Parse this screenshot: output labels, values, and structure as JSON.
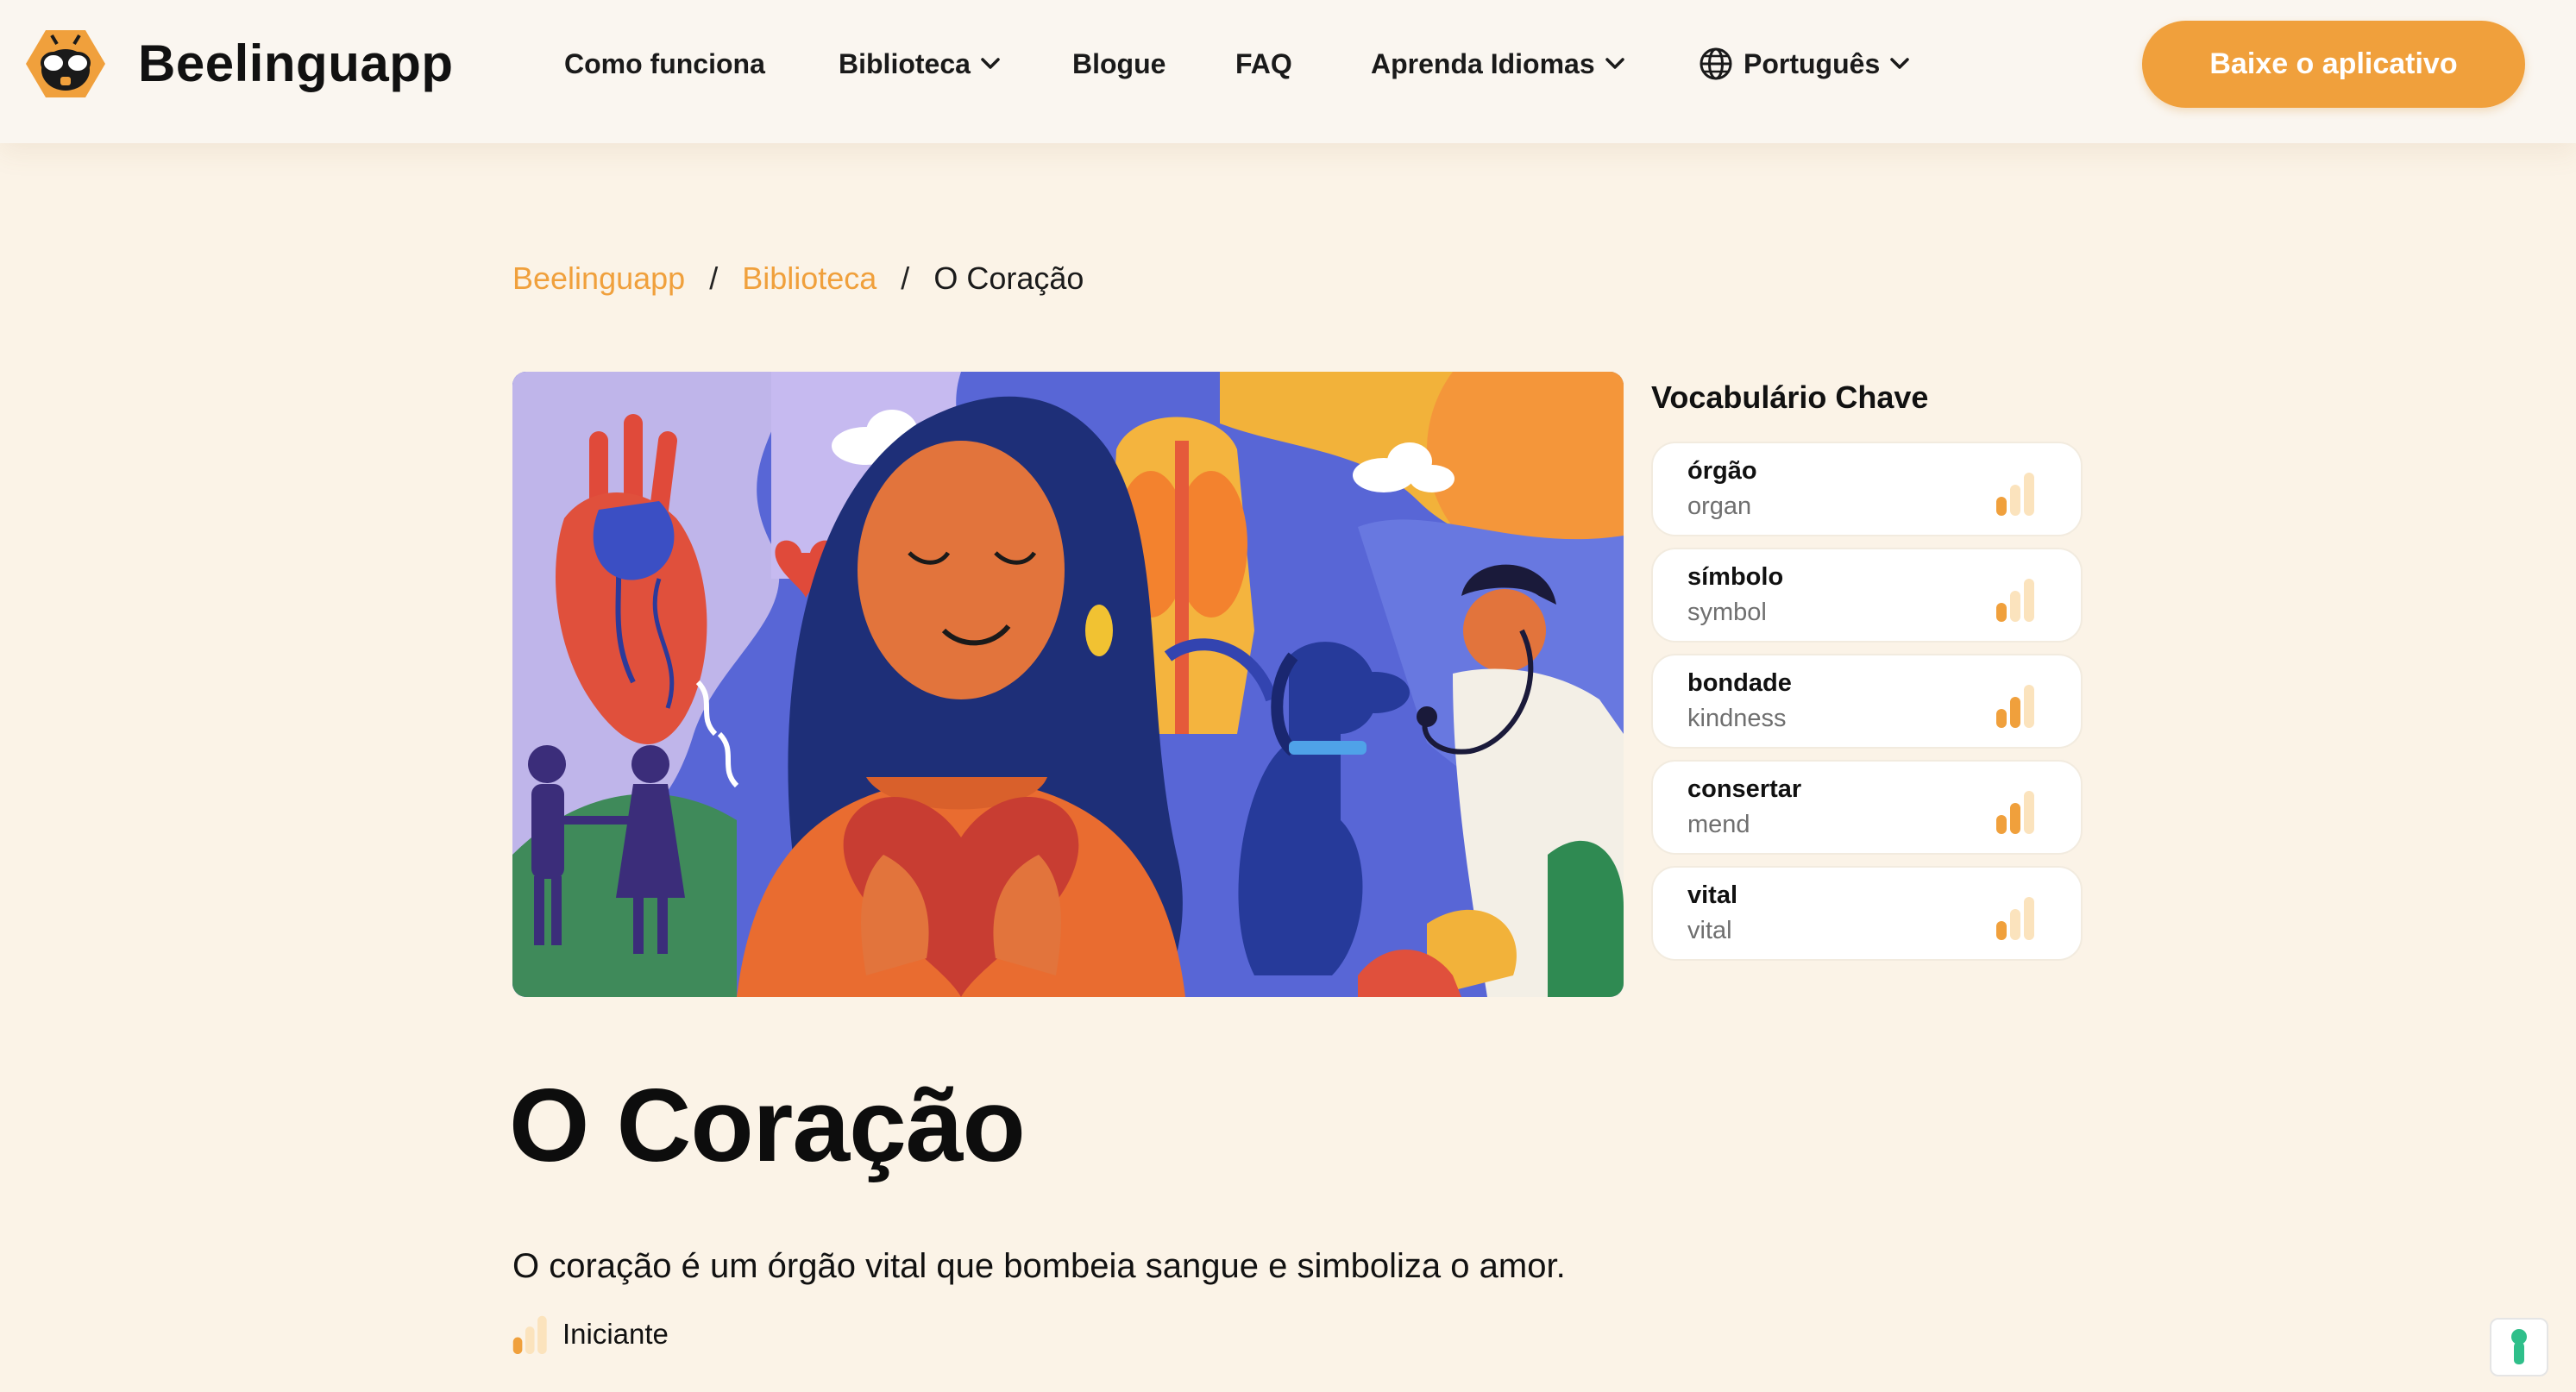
{
  "header": {
    "brand": "Beelinguapp",
    "nav": [
      {
        "label": "Como funciona",
        "dropdown": false
      },
      {
        "label": "Biblioteca",
        "dropdown": true
      },
      {
        "label": "Blogue",
        "dropdown": false
      },
      {
        "label": "FAQ",
        "dropdown": false
      },
      {
        "label": "Aprenda Idiomas",
        "dropdown": true
      }
    ],
    "language": "Português",
    "cta": "Baixe o aplicativo",
    "accent": "#f0a03c"
  },
  "breadcrumb": {
    "items": [
      "Beelinguapp",
      "Biblioteca"
    ],
    "separator": "/",
    "current": "O Coração"
  },
  "vocabulary": {
    "title": "Vocabulário Chave",
    "items": [
      {
        "word": "órgão",
        "translation": "organ",
        "level_bars": 1
      },
      {
        "word": "símbolo",
        "translation": "symbol",
        "level_bars": 1
      },
      {
        "word": "bondade",
        "translation": "kindness",
        "level_bars": 2
      },
      {
        "word": "consertar",
        "translation": "mend",
        "level_bars": 2
      },
      {
        "word": "vital",
        "translation": "vital",
        "level_bars": 1
      }
    ]
  },
  "article": {
    "title": "O Coração",
    "description": "O coração é um órgão vital que bombeia sangue e simboliza o amor.",
    "level": "Iniciante",
    "level_bars": 1
  },
  "icons": {
    "logo": "bee-logo-icon",
    "globe": "globe-icon",
    "chevron": "chevron-down-icon",
    "help": "help-widget-icon"
  }
}
